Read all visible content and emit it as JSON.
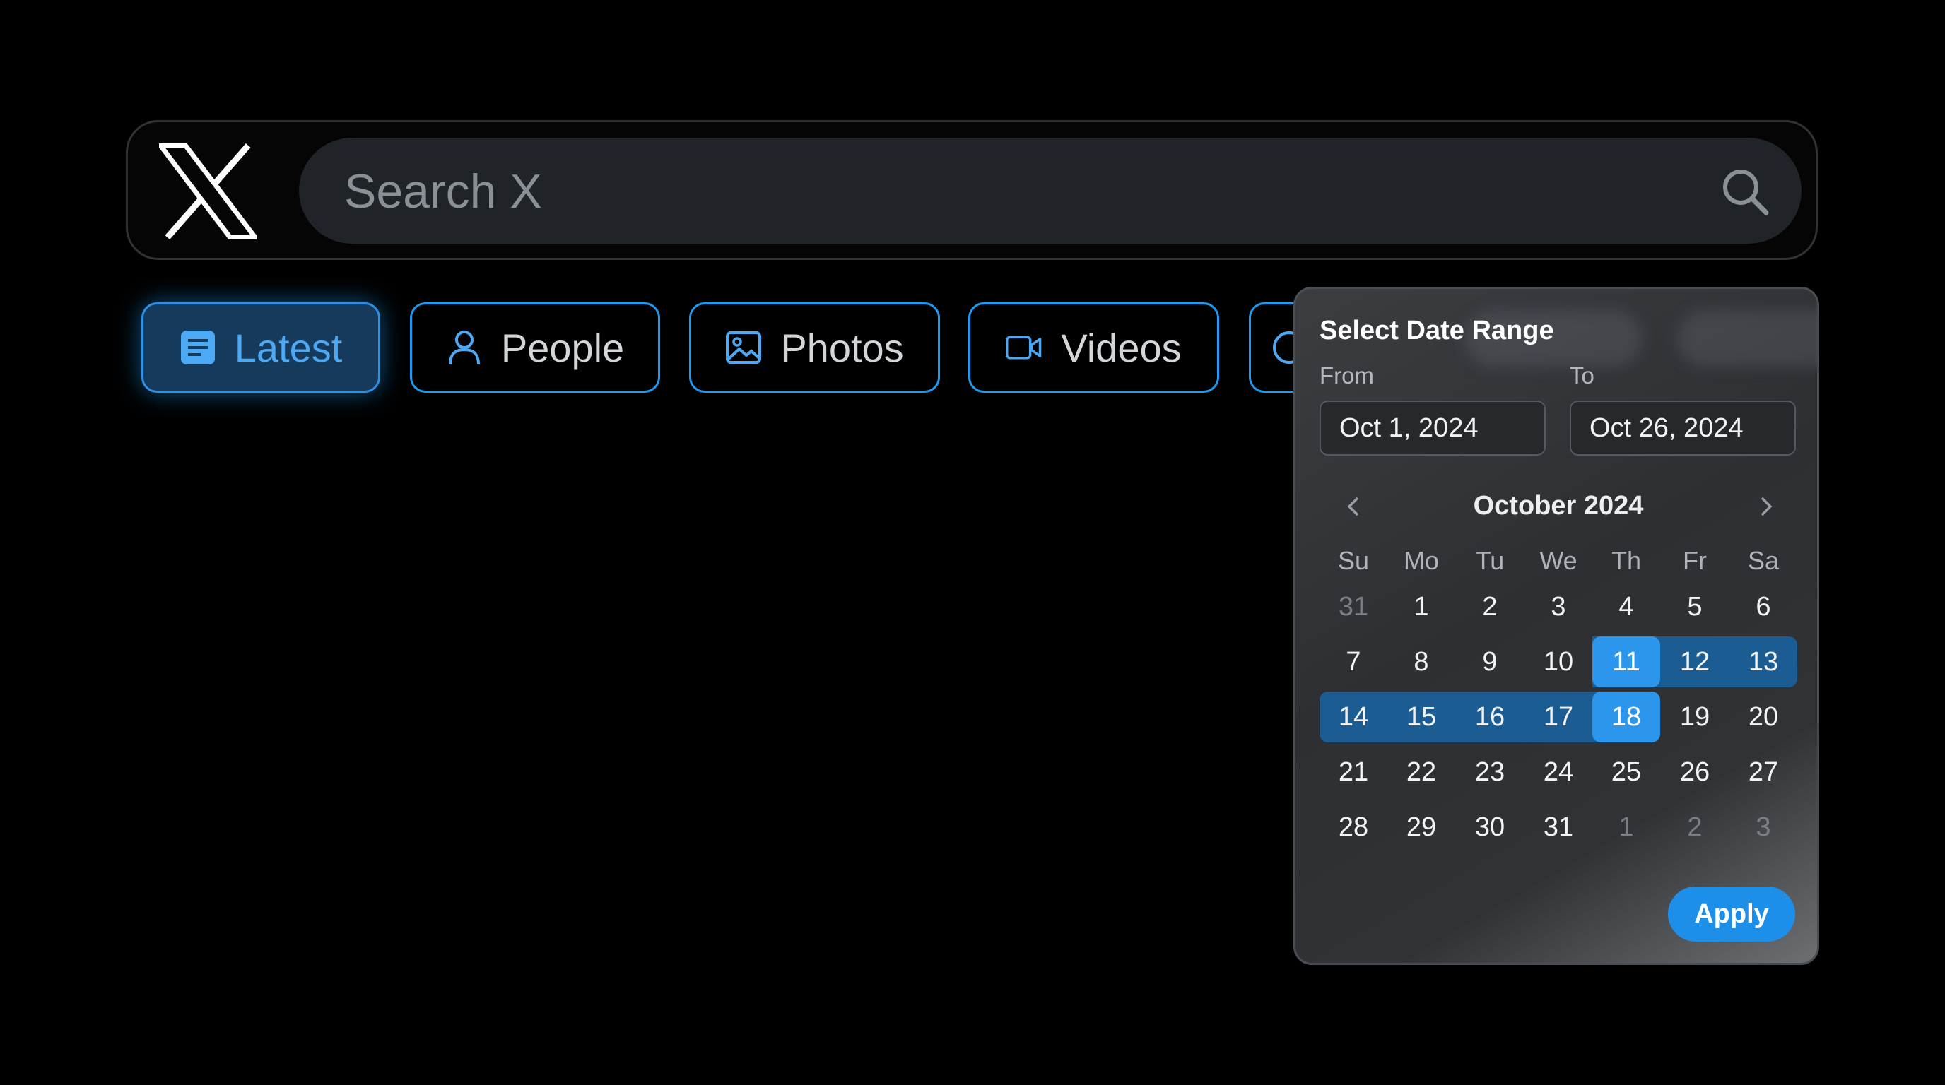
{
  "search": {
    "placeholder": "Search X",
    "value": ""
  },
  "tabs": [
    {
      "label": "Latest",
      "icon": "document-icon",
      "active": true
    },
    {
      "label": "People",
      "icon": "person-icon",
      "active": false
    },
    {
      "label": "Photos",
      "icon": "image-icon",
      "active": false
    },
    {
      "label": "Videos",
      "icon": "video-icon",
      "active": false
    }
  ],
  "date_picker": {
    "title": "Select Date Range",
    "from_label": "From",
    "to_label": "To",
    "from_value": "Oct 1, 2024",
    "to_value": "Oct 26, 2024",
    "month_label": "October 2024",
    "weekdays": [
      "Su",
      "Mo",
      "Tu",
      "We",
      "Th",
      "Fr",
      "Sa"
    ],
    "weeks": [
      [
        "31",
        "1",
        "2",
        "3",
        "4",
        "5",
        "6"
      ],
      [
        "7",
        "8",
        "9",
        "10",
        "11",
        "12",
        "13"
      ],
      [
        "14",
        "15",
        "16",
        "17",
        "18",
        "19",
        "20"
      ],
      [
        "21",
        "22",
        "23",
        "24",
        "25",
        "26",
        "27"
      ],
      [
        "28",
        "29",
        "30",
        "31",
        "1",
        "2",
        "3"
      ]
    ],
    "outside_month_days": [
      "31 (Sep)",
      "1 (Nov)",
      "2 (Nov)",
      "3 (Nov)"
    ],
    "highlighted_start": "11",
    "highlighted_end": "18",
    "apply_label": "Apply"
  },
  "colors": {
    "background": "#000000",
    "accent": "#1d9bf0",
    "range_fill": "#1b5c92",
    "endpoint_fill": "#2b96ec",
    "popover_bg": "#2e3034"
  }
}
